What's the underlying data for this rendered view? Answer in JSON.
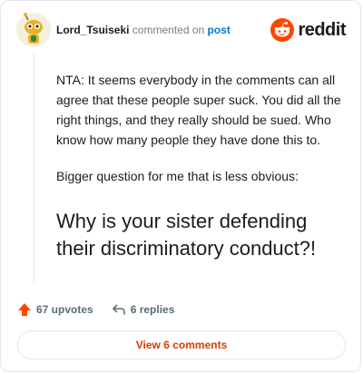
{
  "header": {
    "username": "Lord_Tsuiseki",
    "action_text": " commented on ",
    "post_link": "post",
    "brand_name": "reddit"
  },
  "comment": {
    "paragraph1": "NTA: It seems everybody in the comments can all agree that these people super suck. You did all the right things, and they really should be sued. Who know how many people they have done this to.",
    "paragraph2": "Bigger question for me that is less obvious:",
    "heading": "Why is your sister defending their discriminatory conduct?!"
  },
  "actions": {
    "upvotes": "67 upvotes",
    "replies": "6 replies"
  },
  "footer": {
    "view_button": "View 6 comments"
  },
  "colors": {
    "brand_orange": "#ff4500",
    "link_blue": "#0079d3",
    "button_text": "#d93a00",
    "meta_gray": "#7c7c7c"
  },
  "icons": {
    "upvote": "upvote-arrow-icon",
    "reply": "reply-arrow-icon",
    "brand": "reddit-logo-icon"
  }
}
